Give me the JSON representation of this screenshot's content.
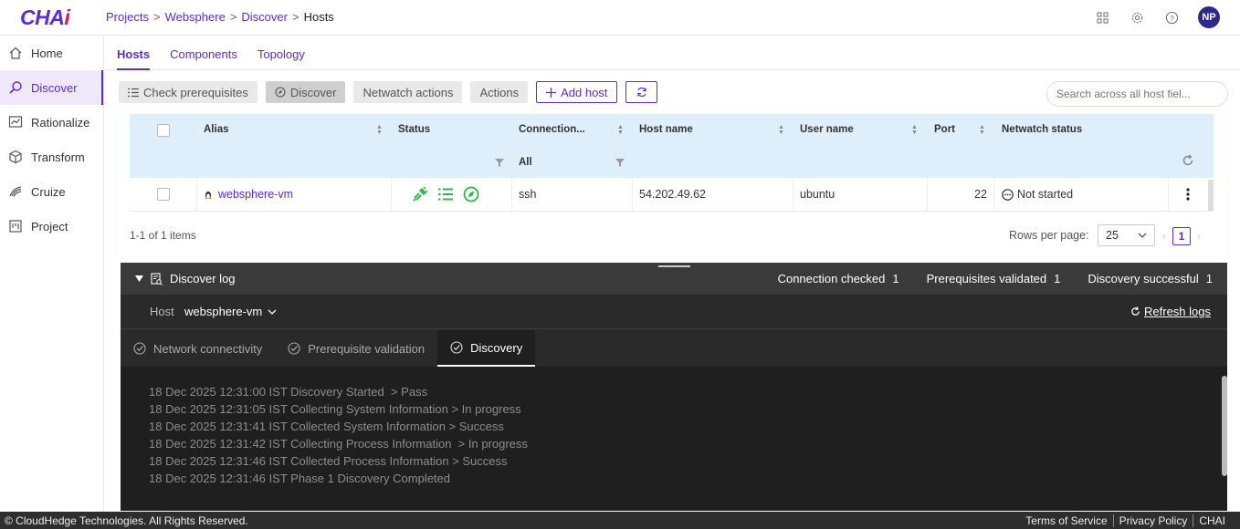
{
  "app": {
    "logo_main": "CHA",
    "logo_accent": "i"
  },
  "breadcrumb": [
    "Projects",
    "Websphere",
    "Discover",
    "Hosts"
  ],
  "user": {
    "initials": "NP"
  },
  "sidebar": {
    "items": [
      {
        "label": "Home",
        "icon": "home-icon"
      },
      {
        "label": "Discover",
        "icon": "discover-icon",
        "active": true
      },
      {
        "label": "Rationalize",
        "icon": "rationalize-icon"
      },
      {
        "label": "Transform",
        "icon": "transform-icon"
      },
      {
        "label": "Cruize",
        "icon": "cruize-icon"
      },
      {
        "label": "Project",
        "icon": "project-icon"
      }
    ]
  },
  "tabs": [
    "Hosts",
    "Components",
    "Topology"
  ],
  "toolbar": {
    "check_prerequisites": "Check prerequisites",
    "discover": "Discover",
    "netwatch_actions": "Netwatch actions",
    "actions": "Actions",
    "add_host": "Add host"
  },
  "search": {
    "placeholder": "Search across all host fiel..."
  },
  "table": {
    "columns": [
      "Alias",
      "Status",
      "Connection...",
      "Host name",
      "User name",
      "Port",
      "Netwatch status"
    ],
    "connection_filter": "All",
    "rows": [
      {
        "alias": "websphere-vm",
        "connection": "ssh",
        "host_name": "54.202.49.62",
        "user_name": "ubuntu",
        "port": "22",
        "netwatch_status": "Not started"
      }
    ],
    "summary": "1-1 of 1 items",
    "rows_per_page_label": "Rows per page:",
    "rows_per_page": "25",
    "page": "1"
  },
  "log": {
    "title": "Discover log",
    "stats": [
      {
        "label": "Connection checked",
        "count": "1"
      },
      {
        "label": "Prerequisites validated",
        "count": "1"
      },
      {
        "label": "Discovery successful",
        "count": "1"
      }
    ],
    "host_label": "Host",
    "host_value": "websphere-vm",
    "refresh_label": "Refresh logs",
    "tabs": [
      "Network connectivity",
      "Prerequisite validation",
      "Discovery"
    ],
    "lines": [
      "18 Dec 2025 12:31:00 IST Discovery Started  > Pass",
      "18 Dec 2025 12:31:05 IST Collecting System Information > In progress",
      "18 Dec 2025 12:31:41 IST Collected System Information > Success",
      "18 Dec 2025 12:31:42 IST Collecting Process Information  > In progress",
      "18 Dec 2025 12:31:46 IST Collected Process Information > Success",
      "18 Dec 2025 12:31:46 IST Phase 1 Discovery Completed"
    ]
  },
  "footer": {
    "copyright": "© CloudHedge Technologies. All Rights Reserved.",
    "links": [
      "Terms of Service",
      "Privacy Policy",
      "CHAI"
    ]
  },
  "colors": {
    "accent": "#5b2bd9",
    "brand_pink": "#d5156d",
    "success_green": "#2fb84a"
  }
}
